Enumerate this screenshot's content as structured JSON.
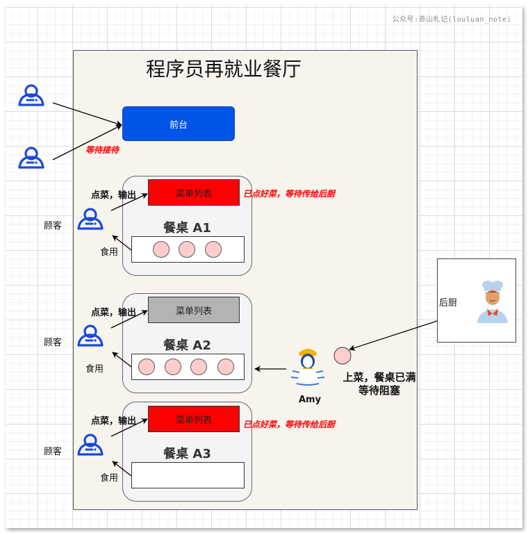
{
  "watermark": "公众号:赤山札记(louluan_note)",
  "title": "程序员再就业餐厅",
  "front_desk": {
    "label": "前台",
    "waiting_note": "等待接待"
  },
  "colors": {
    "front_desk": "#0055e8",
    "customer_icon": "#1848e0",
    "menu_ordered": "#ff0000",
    "menu_pending": "#b3b3b3",
    "dish": "#ffcccc",
    "note_red": "#ff0000",
    "restaurant_bg": "#f7f4ee"
  },
  "tables": [
    {
      "name": "餐桌 A1",
      "menu_label": "菜单列表",
      "menu_status": "ordered",
      "order_label": "点菜，输出",
      "customer_label": "顾客",
      "eat_label": "食用",
      "dish_count": 3,
      "note": "已点好菜，等待传给后厨"
    },
    {
      "name": "餐桌 A2",
      "menu_label": "菜单列表",
      "menu_status": "pending",
      "order_label": "点菜，输出",
      "customer_label": "顾客",
      "eat_label": "食用",
      "dish_count": 4,
      "note": ""
    },
    {
      "name": "餐桌 A3",
      "menu_label": "菜单列表",
      "menu_status": "ordered",
      "order_label": "点菜，输出",
      "customer_label": "顾客",
      "eat_label": "食用",
      "dish_count": 0,
      "note": "已点好菜，等待传给后厨"
    }
  ],
  "kitchen": {
    "label": "后厨",
    "icon": "chef-icon"
  },
  "waiter": {
    "name": "Amy",
    "icon": "waitress-icon",
    "note_line1": "上菜，餐桌已满",
    "note_line2": "等待阻塞"
  },
  "icons": {
    "customer": "user-icon",
    "dish": "dish-circle"
  }
}
